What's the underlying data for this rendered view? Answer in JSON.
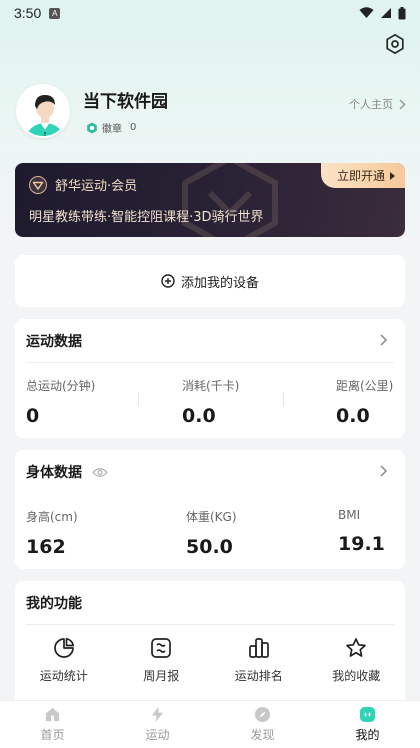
{
  "status_bar": {
    "time": "3:50",
    "notification_letter": "A"
  },
  "profile": {
    "username": "当下软件园",
    "badge_label": "徽章",
    "badge_count": "0",
    "homepage_link": "个人主页"
  },
  "vip": {
    "title": "舒华运动·会员",
    "subtitle": "明星教练带练·智能控阻课程·3D骑行世界",
    "button_label": "立即开通"
  },
  "device": {
    "add_label": "添加我的设备"
  },
  "sport_data": {
    "title": "运动数据",
    "stats": [
      {
        "label": "总运动(分钟)",
        "value": "0"
      },
      {
        "label": "消耗(千卡)",
        "value": "0.0"
      },
      {
        "label": "距离(公里)",
        "value": "0.0"
      }
    ]
  },
  "body_data": {
    "title": "身体数据",
    "stats": [
      {
        "label": "身高(cm)",
        "value": "162"
      },
      {
        "label": "体重(KG)",
        "value": "50.0"
      },
      {
        "label": "BMI",
        "value": "19.1"
      }
    ]
  },
  "functions": {
    "title": "我的功能",
    "items": [
      {
        "label": "运动统计",
        "icon": "pie-chart-icon"
      },
      {
        "label": "周月报",
        "icon": "report-icon"
      },
      {
        "label": "运动排名",
        "icon": "ranking-icon"
      },
      {
        "label": "我的收藏",
        "icon": "star-icon"
      }
    ]
  },
  "tabbar": {
    "tabs": [
      {
        "label": "首页",
        "icon": "home-icon",
        "active": false
      },
      {
        "label": "运动",
        "icon": "lightning-icon",
        "active": false
      },
      {
        "label": "发现",
        "icon": "compass-icon",
        "active": false
      },
      {
        "label": "我的",
        "icon": "profile-icon",
        "active": true
      }
    ]
  },
  "colors": {
    "accent_green": "#2fd3b5",
    "vip_gold": "#f6c99a",
    "vip_dark": "#1e1a2e"
  }
}
